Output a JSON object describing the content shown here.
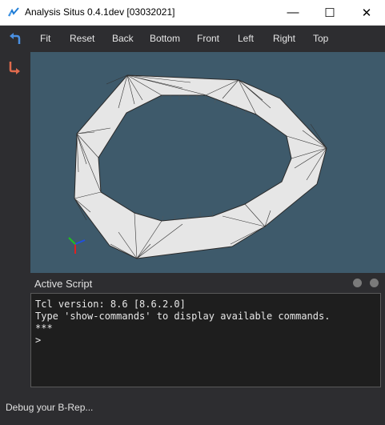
{
  "window": {
    "title": "Analysis Situs 0.4.1dev [03032021]",
    "minimize_glyph": "—",
    "maximize_glyph": "☐",
    "close_glyph": "✕"
  },
  "toolbar": {
    "items": [
      "Fit",
      "Reset",
      "Back",
      "Bottom",
      "Front",
      "Left",
      "Right",
      "Top"
    ]
  },
  "sidebar": {
    "icons": [
      "undo-icon",
      "redo-icon"
    ]
  },
  "viewport": {
    "background": "#3e5a6b",
    "model_color": "#e6e6e6"
  },
  "script_panel": {
    "title": "Active Script"
  },
  "console": {
    "lines": [
      "Tcl version: 8.6 [8.6.2.0]",
      "Type 'show-commands' to display available commands.",
      "***",
      ">"
    ]
  },
  "status": {
    "text": "Debug your B-Rep..."
  }
}
